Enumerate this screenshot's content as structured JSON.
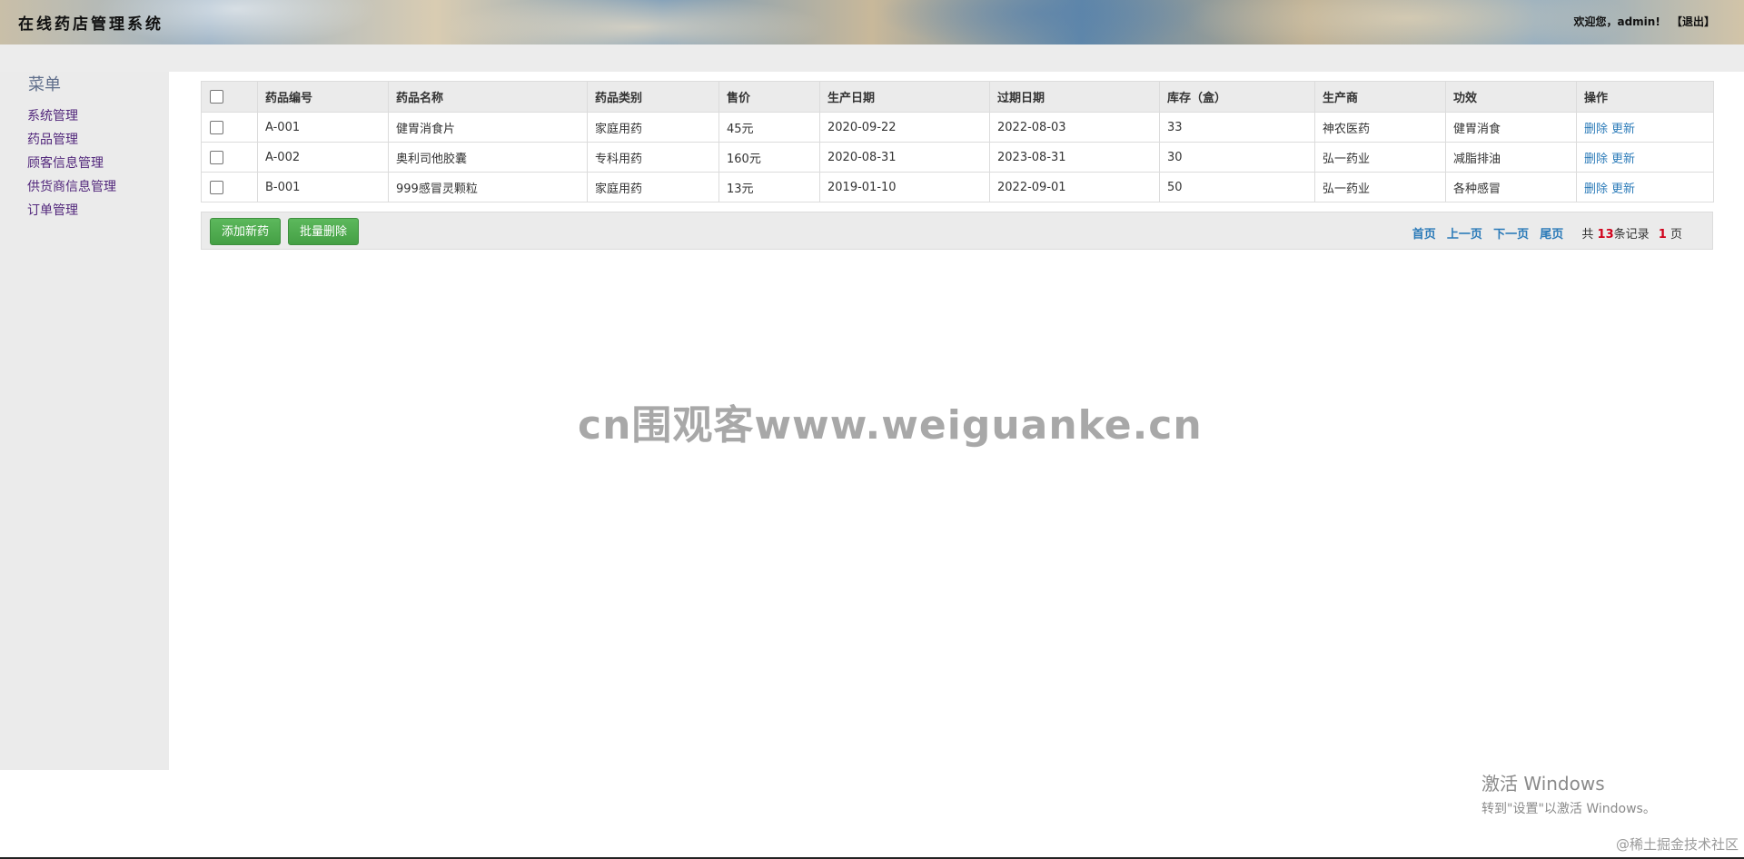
{
  "header": {
    "title": "在线药店管理系统",
    "welcome": "欢迎您，admin!",
    "logout": "【退出】"
  },
  "sidebar": {
    "title": "菜单",
    "items": [
      {
        "label": "系统管理"
      },
      {
        "label": "药品管理"
      },
      {
        "label": "顾客信息管理"
      },
      {
        "label": "供货商信息管理"
      },
      {
        "label": "订单管理"
      }
    ]
  },
  "table": {
    "columns": [
      "药品编号",
      "药品名称",
      "药品类别",
      "售价",
      "生产日期",
      "过期日期",
      "库存（盒）",
      "生产商",
      "功效",
      "操作"
    ],
    "rows": [
      {
        "code": "A-001",
        "name": "健胃消食片",
        "category": "家庭用药",
        "price": "45元",
        "production_date": "2020-09-22",
        "expiry_date": "2022-08-03",
        "stock": "33",
        "manufacturer": "神农医药",
        "effect": "健胃消食",
        "delete": "删除",
        "update": "更新"
      },
      {
        "code": "A-002",
        "name": "奥利司他胶囊",
        "category": "专科用药",
        "price": "160元",
        "production_date": "2020-08-31",
        "expiry_date": "2023-08-31",
        "stock": "30",
        "manufacturer": "弘一药业",
        "effect": "减脂排油",
        "delete": "删除",
        "update": "更新"
      },
      {
        "code": "B-001",
        "name": "999感冒灵颗粒",
        "category": "家庭用药",
        "price": "13元",
        "production_date": "2019-01-10",
        "expiry_date": "2022-09-01",
        "stock": "50",
        "manufacturer": "弘一药业",
        "effect": "各种感冒",
        "delete": "删除",
        "update": "更新"
      }
    ]
  },
  "actions": {
    "add": "添加新药",
    "batch_delete": "批量删除"
  },
  "pager": {
    "first": "首页",
    "prev": "上一页",
    "next": "下一页",
    "last": "尾页",
    "total_prefix": "共",
    "total_records": "13",
    "records_suffix": "条记录",
    "total_pages": "1",
    "pages_suffix": "页"
  },
  "overlays": {
    "watermark": "cn围观客www.weiguanke.cn",
    "activate_title": "激活 Windows",
    "activate_sub": "转到\"设置\"以激活 Windows。",
    "corner": "@稀土掘金技术社区"
  },
  "colors": {
    "link": "#2a7ab8",
    "menu": "#51267b",
    "button": "#5cb85c",
    "highlight": "#d0021b"
  }
}
